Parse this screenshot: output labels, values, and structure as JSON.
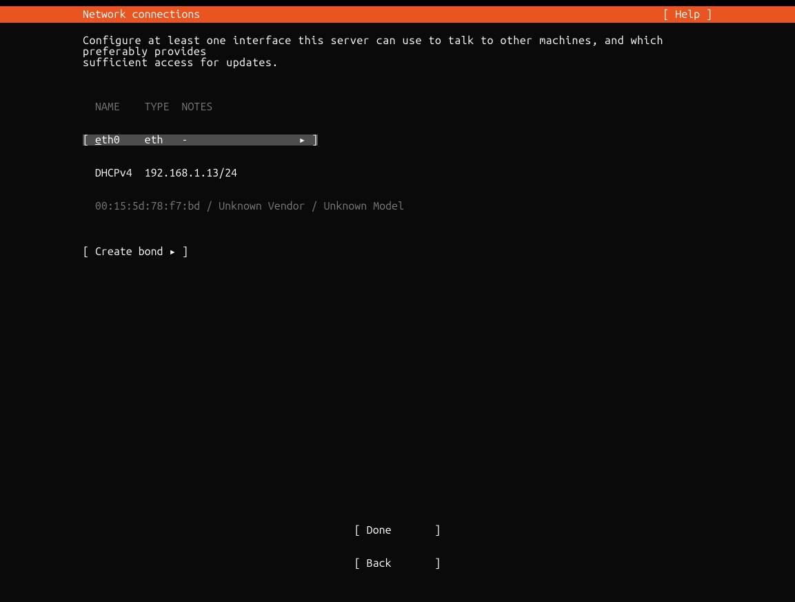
{
  "header": {
    "title": "Network connections",
    "help": "[ Help ]"
  },
  "description": "Configure at least one interface this server can use to talk to other machines, and which preferably provides\nsufficient access for updates.",
  "columns": {
    "name": "NAME",
    "type": "TYPE",
    "notes": "NOTES"
  },
  "interface": {
    "lbracket": "[",
    "name_underlined": "e",
    "name_rest": "th0",
    "type": "eth",
    "notes": "-",
    "arrow": "▸",
    "rbracket": "]"
  },
  "interface_details": {
    "dhcp_label": "DHCPv4",
    "dhcp_value": "192.168.1.13/24",
    "hw": "00:15:5d:78:f7:bd / Unknown Vendor / Unknown Model"
  },
  "bond": {
    "lbracket": "[",
    "label": "Create bond",
    "arrow": "▸",
    "rbracket": "]"
  },
  "footer": {
    "done": "[ Done       ]",
    "back": "[ Back       ]"
  }
}
